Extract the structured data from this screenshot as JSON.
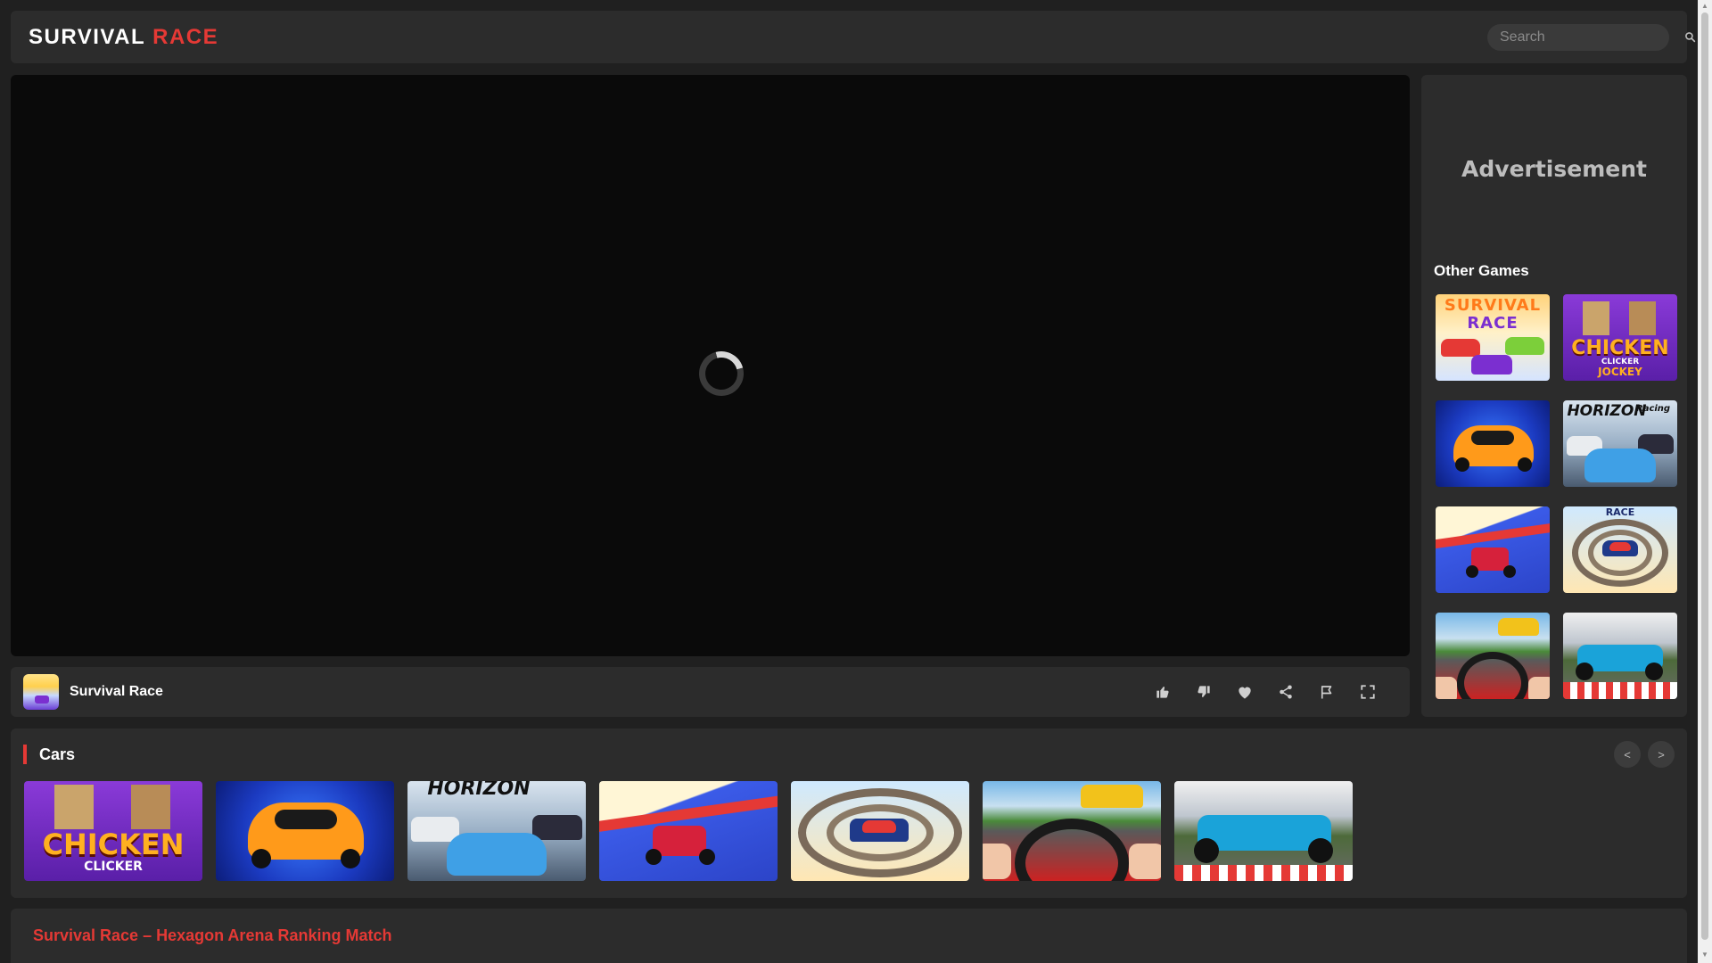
{
  "header": {
    "logo_word1": "SURVIVAL",
    "logo_word2": "RACE",
    "search_placeholder": "Search"
  },
  "player": {
    "state": "loading"
  },
  "info_bar": {
    "game_title": "Survival Race",
    "actions": [
      "thumbs-up-icon",
      "thumbs-down-icon",
      "heart-icon",
      "share-icon",
      "flag-icon",
      "fullscreen-icon"
    ]
  },
  "sidebar": {
    "ad_label": "Advertisement",
    "other_games_title": "Other Games",
    "thumb_texts": {
      "survival_race": [
        "SURVIVAL",
        "RACE"
      ],
      "chicken": [
        "CHICKEN",
        "CLICKER",
        "JOCKEY"
      ],
      "horizon": [
        "HORIZON",
        "Racing"
      ],
      "stunt_race": "RACE"
    }
  },
  "cars": {
    "title": "Cars",
    "prev_label": "<",
    "next_label": ">",
    "thumb_texts": {
      "chicken": [
        "CHICKEN",
        "CLICKER"
      ],
      "horizon": "HORIZON"
    }
  },
  "description": {
    "title": "Survival Race – Hexagon Arena Ranking Match"
  },
  "colors": {
    "accent": "#e53935",
    "panel": "#2c2c2c",
    "background": "#202020",
    "player": "#0a0a0a"
  }
}
